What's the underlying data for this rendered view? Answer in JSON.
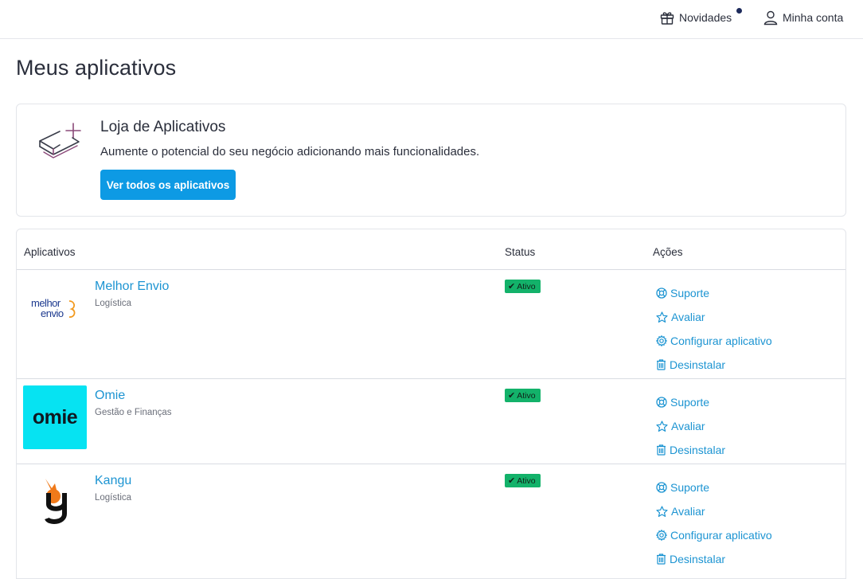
{
  "topbar": {
    "news_label": "Novidades",
    "account_label": "Minha conta"
  },
  "page": {
    "title": "Meus aplicativos"
  },
  "store": {
    "title": "Loja de Aplicativos",
    "description": "Aumente o potencial do seu negócio adicionando mais funcionalidades.",
    "button_label": "Ver todos os aplicativos"
  },
  "table": {
    "headers": {
      "apps": "Aplicativos",
      "status": "Status",
      "actions": "Ações"
    },
    "rows": [
      {
        "name": "Melhor Envio",
        "category": "Logística",
        "status": "Ativo",
        "logo_text": "melhor envio",
        "actions": {
          "support": "Suporte",
          "rate": "Avaliar",
          "configure": "Configurar aplicativo",
          "uninstall": "Desinstalar"
        }
      },
      {
        "name": "Omie",
        "category": "Gestão e Finanças",
        "status": "Ativo",
        "logo_text": "omie",
        "actions": {
          "support": "Suporte",
          "rate": "Avaliar",
          "uninstall": "Desinstalar"
        }
      },
      {
        "name": "Kangu",
        "category": "Logística",
        "status": "Ativo",
        "actions": {
          "support": "Suporte",
          "rate": "Avaliar",
          "configure": "Configurar aplicativo",
          "uninstall": "Desinstalar"
        }
      }
    ]
  },
  "colors": {
    "accent": "#0d9ae4",
    "link": "#1c94d2",
    "status_active": "#13b26a"
  },
  "icons": [
    "gift-icon",
    "user-icon",
    "app-store-icon",
    "support-icon",
    "star-icon",
    "gear-icon",
    "trash-icon",
    "check-icon"
  ]
}
